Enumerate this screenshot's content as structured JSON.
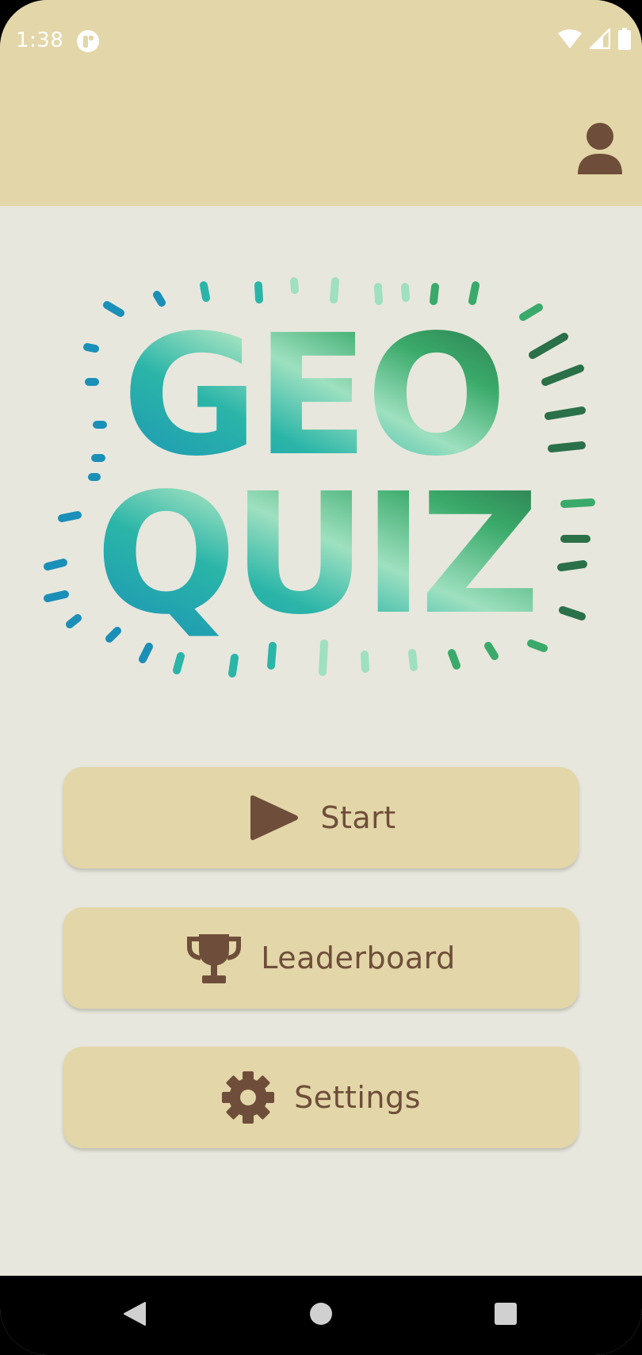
{
  "status_bar": {
    "time": "1:38"
  },
  "app_bar": {
    "profile_icon": "person-icon"
  },
  "logo": {
    "line1": "GEO",
    "line2": "QUIZ",
    "colors": {
      "blue": "#1a8fb8",
      "teal": "#2ab5a8",
      "mint": "#9ee0c0",
      "green": "#3aaa6a",
      "dark_green": "#2a7048"
    }
  },
  "menu": {
    "start": {
      "label": "Start",
      "icon": "play-icon"
    },
    "leaderboard": {
      "label": "Leaderboard",
      "icon": "trophy-icon"
    },
    "settings": {
      "label": "Settings",
      "icon": "gear-icon"
    }
  },
  "colors": {
    "background": "#e8e7dd",
    "accent": "#e3d6a8",
    "icon_brown": "#6e4e3a",
    "nav_bar": "#000000"
  }
}
